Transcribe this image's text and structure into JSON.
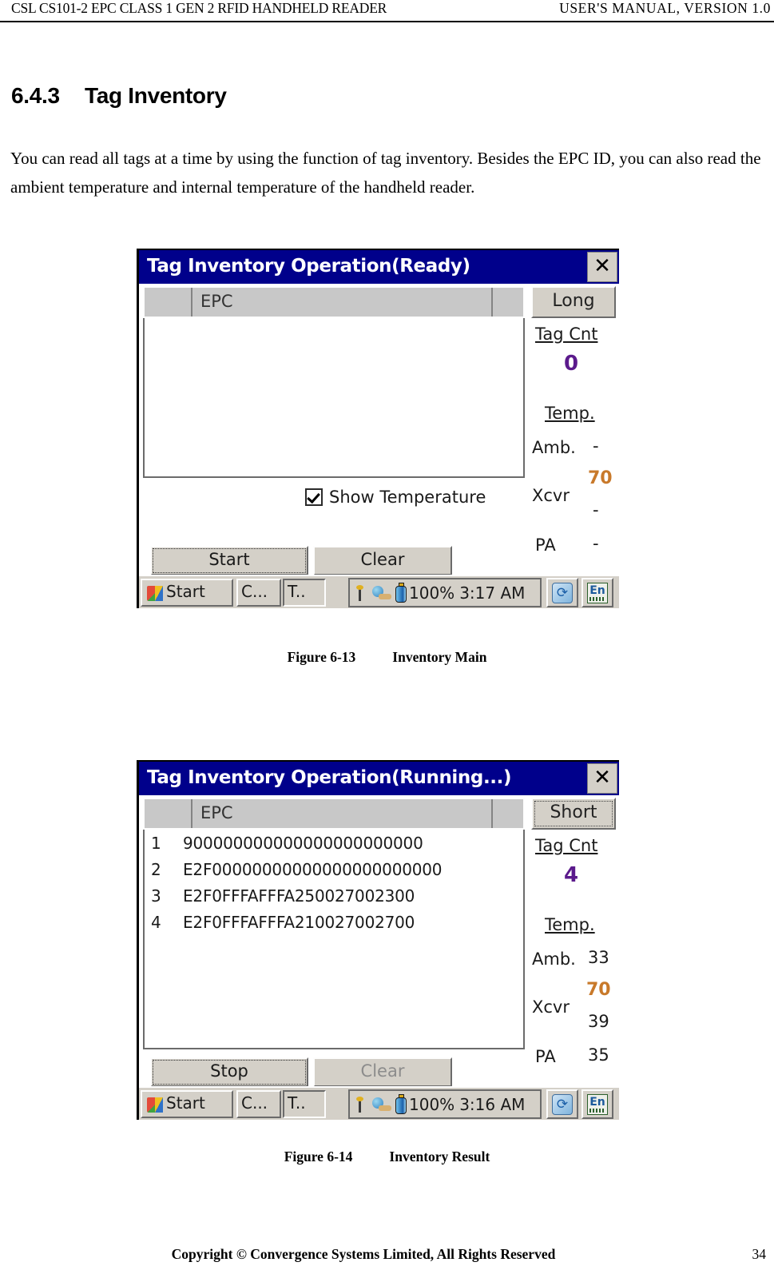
{
  "header": {
    "left": "CSL CS101-2 EPC CLASS 1 GEN 2 RFID HANDHELD READER",
    "right": "USER'S  MANUAL,  VERSION  1.0"
  },
  "section": {
    "number": "6.4.3",
    "title": "Tag Inventory",
    "paragraph": "You can read all tags at a time by using the function of tag inventory. Besides the EPC ID, you can also read the ambient temperature and internal temperature of the handheld reader."
  },
  "figures": [
    {
      "caption_label": "Figure 6-13",
      "caption_text": "Inventory Main",
      "window": {
        "title": "Tag Inventory Operation(Ready)",
        "close_label": "✕",
        "column_header_epc": "EPC",
        "mode_button": "Long",
        "rows": [],
        "checkbox_label": "Show Temperature",
        "checkbox_checked": true,
        "buttons": {
          "primary": "Start",
          "secondary": "Clear",
          "secondary_disabled": false
        },
        "panel": {
          "tag_count_label": "Tag Cnt",
          "tag_count_value": "0",
          "temp_label": "Temp.",
          "amb_label": "Amb.",
          "amb_value": "-",
          "xcvr_label": "Xcvr",
          "xcvr_value_top": "70",
          "xcvr_value_bottom": "-",
          "pa_label": "PA",
          "pa_value": "-"
        },
        "taskbar": {
          "start_label": "Start",
          "task1": "C...",
          "task2": "T..",
          "battery": "100%",
          "time": "3:17 AM",
          "input_icon_label": "En",
          "refresh_icon_label": "⟳"
        }
      }
    },
    {
      "caption_label": "Figure 6-14",
      "caption_text": "Inventory Result",
      "window": {
        "title": "Tag Inventory Operation(Running...)",
        "close_label": "✕",
        "column_header_epc": "EPC",
        "mode_button": "Short",
        "rows": [
          {
            "index": "1",
            "epc": "900000000000000000000000"
          },
          {
            "index": "2",
            "epc": "E2F00000000000000000000000"
          },
          {
            "index": "3",
            "epc": "E2F0FFFAFFFA250027002300"
          },
          {
            "index": "4",
            "epc": "E2F0FFFAFFFA210027002700"
          }
        ],
        "checkbox_label": "",
        "checkbox_checked": false,
        "buttons": {
          "primary": "Stop",
          "secondary": "Clear",
          "secondary_disabled": true
        },
        "panel": {
          "tag_count_label": "Tag Cnt",
          "tag_count_value": "4",
          "temp_label": "Temp.",
          "amb_label": "Amb.",
          "amb_value": "33",
          "xcvr_label": "Xcvr",
          "xcvr_value_top": "70",
          "xcvr_value_bottom": "39",
          "pa_label": "PA",
          "pa_value": "35"
        },
        "taskbar": {
          "start_label": "Start",
          "task1": "C...",
          "task2": "T..",
          "battery": "100%",
          "time": "3:16 AM",
          "input_icon_label": "En",
          "refresh_icon_label": "⟳"
        }
      }
    }
  ],
  "footer": {
    "copyright": "Copyright © Convergence Systems Limited, All Rights Reserved",
    "page_number": "34"
  },
  "colors": {
    "titlebar": "#00008b",
    "tag_count": "#5b1a8c",
    "temp_highlight": "#c8792a",
    "chrome": "#d4d0c8"
  }
}
